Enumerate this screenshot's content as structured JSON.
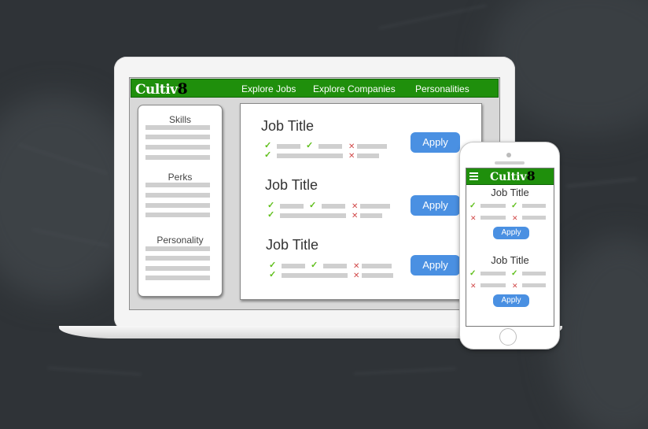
{
  "desktop": {
    "brand": {
      "name": "Cultiv",
      "digit": "8"
    },
    "nav": [
      "Explore Jobs",
      "Explore Companies",
      "Personalities"
    ],
    "filters": {
      "skills": "Skills",
      "perks": "Perks",
      "personality": "Personality"
    },
    "jobs": [
      {
        "title": "Job Title",
        "apply": "Apply"
      },
      {
        "title": "Job Title",
        "apply": "Apply"
      },
      {
        "title": "Job Title",
        "apply": "Apply"
      }
    ]
  },
  "mobile": {
    "brand": {
      "name": "Cultiv",
      "digit": "8"
    },
    "jobs": [
      {
        "title": "Job Title",
        "apply": "Apply"
      },
      {
        "title": "Job Title",
        "apply": "Apply"
      }
    ]
  },
  "icons": {
    "match": "check-icon",
    "mismatch": "x-icon",
    "menu": "hamburger-icon"
  },
  "colors": {
    "brand_green": "#1f8f0c",
    "apply_blue": "#4a90e2",
    "check_green": "#5fbf1a",
    "cross_red": "#d14848"
  }
}
